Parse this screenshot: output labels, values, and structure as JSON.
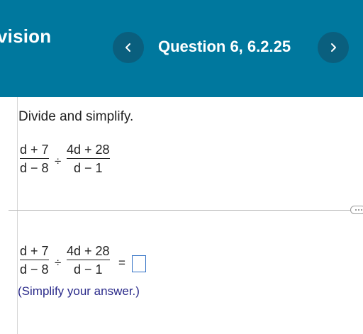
{
  "header": {
    "section_title": "vision",
    "question_label": "Question 6, 6.2.25",
    "prev_symbol": "<",
    "next_symbol": ">"
  },
  "problem": {
    "instruction": "Divide and simplify.",
    "expression": {
      "left_numerator": "d + 7",
      "left_denominator": "d − 8",
      "operator": "÷",
      "right_numerator": "4d + 28",
      "right_denominator": "d − 1"
    }
  },
  "answer": {
    "left_numerator": "d + 7",
    "left_denominator": "d − 8",
    "operator": "÷",
    "right_numerator": "4d + 28",
    "right_denominator": "d − 1",
    "equals": "=",
    "input_value": "",
    "hint": "(Simplify your answer.)"
  },
  "colors": {
    "header_bg": "#00789e",
    "nav_button_bg": "#0a5f7e",
    "hint_text": "#2a2a8a",
    "answer_box_border": "#2f6fc4"
  },
  "icons": {
    "prev": "chevron-left-icon",
    "next": "chevron-right-icon",
    "divider": "drag-handle-icon"
  }
}
